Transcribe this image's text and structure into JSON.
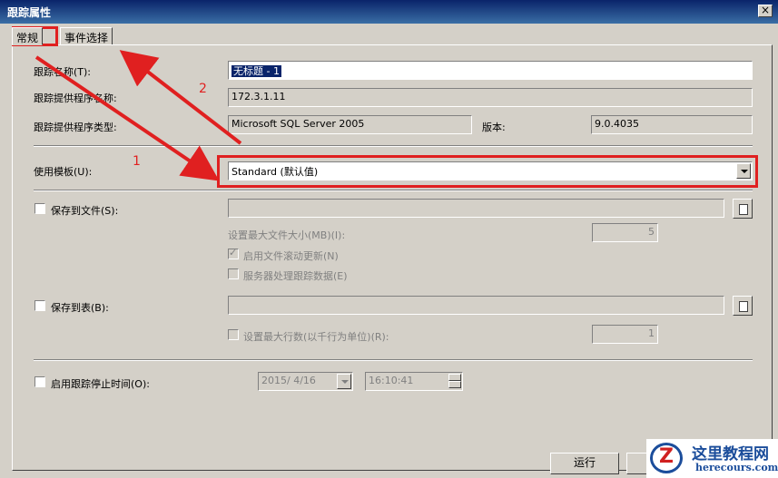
{
  "window": {
    "title": "跟踪属性",
    "close_glyph": "×"
  },
  "tabs": [
    {
      "label": "常规",
      "active": true
    },
    {
      "label": "事件选择",
      "active": false
    }
  ],
  "general": {
    "trace_name_label": "跟踪名称(T):",
    "trace_name_value": "无标题 - 1",
    "provider_name_label": "跟踪提供程序名称:",
    "provider_name_value": "172.3.1.11",
    "provider_type_label": "跟踪提供程序类型:",
    "provider_type_value": "Microsoft SQL Server 2005",
    "version_label": "版本:",
    "version_value": "9.0.4035",
    "template_label": "使用模板(U):",
    "template_value": "Standard (默认值)"
  },
  "save_file": {
    "label": "保存到文件(S):",
    "path_value": "",
    "max_size_label": "设置最大文件大小(MB)(I):",
    "max_size_value": "5",
    "rollover_label": "启用文件滚动更新(N)",
    "rollover_checked": true,
    "server_process_label": "服务器处理跟踪数据(E)",
    "server_process_checked": false
  },
  "save_table": {
    "label": "保存到表(B):",
    "table_value": "",
    "max_rows_label": "设置最大行数(以千行为单位)(R):",
    "max_rows_value": "1"
  },
  "stop_time": {
    "label": "启用跟踪停止时间(O):",
    "date_value": "2015/ 4/16",
    "time_value": "16:10:41"
  },
  "buttons": {
    "run": "运行"
  },
  "annotations": {
    "one": "1",
    "two": "2"
  },
  "watermark": {
    "logo_letter": "Z",
    "title": "这里教程网",
    "url": "herecours.com"
  },
  "colors": {
    "annotation_red": "#e02020",
    "title_blue": "#0a246a",
    "watermark_blue": "#1b4d9b"
  }
}
